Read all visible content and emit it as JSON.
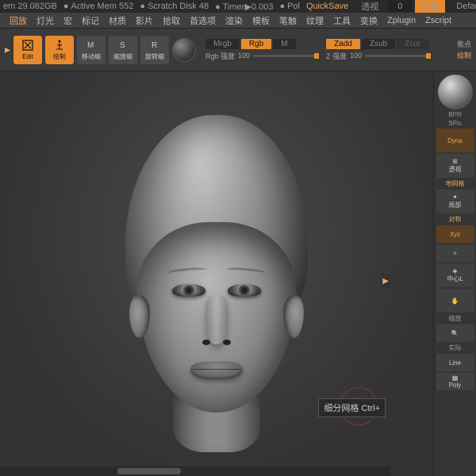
{
  "status": {
    "mem": "em 29.082GB",
    "active_mem": "Active Mem 552",
    "scratch": "Scratch Disk 48",
    "timer": "Timer▶0.003",
    "pol": "Pol",
    "quicksave": "QuickSave",
    "view": "透视",
    "view_val": "0",
    "menu": "菜单",
    "profile": "DefaultZSc"
  },
  "menu": [
    "回放",
    "灯光",
    "宏",
    "标记",
    "材质",
    "影片",
    "拾取",
    "首选项",
    "渲染",
    "模板",
    "笔触",
    "纹理",
    "工具",
    "变换",
    "Zplugin",
    "Zscript"
  ],
  "toolbar": {
    "edit": "Edit",
    "draw": "绘制",
    "move": "移动缩",
    "scale": "缩放缩",
    "rotate": "旋转缩"
  },
  "modes": {
    "mrgb": "Mrgb",
    "rgb": "Rgb",
    "m": "M",
    "zadd": "Zadd",
    "zsub": "Zsub",
    "zcut": "Zcut",
    "rgb_intensity_label": "Rgb 强度",
    "rgb_intensity_val": "100",
    "z_intensity_label": "Z 强度",
    "z_intensity_val": "100"
  },
  "right": {
    "bpr": "BPR",
    "spix": "SPix",
    "dyn": "Dyna",
    "persp": "透视",
    "floor": "地网格",
    "local": "局部",
    "sym": "对称",
    "xyz": "Xyz",
    "center": "中心L",
    "frame": "缩放",
    "actual": "实际",
    "line": "Line",
    "poly": "Poly",
    "focus_top": "焦点",
    "paint_top": "绘制"
  },
  "tooltip": "细分网格 Ctrl+"
}
